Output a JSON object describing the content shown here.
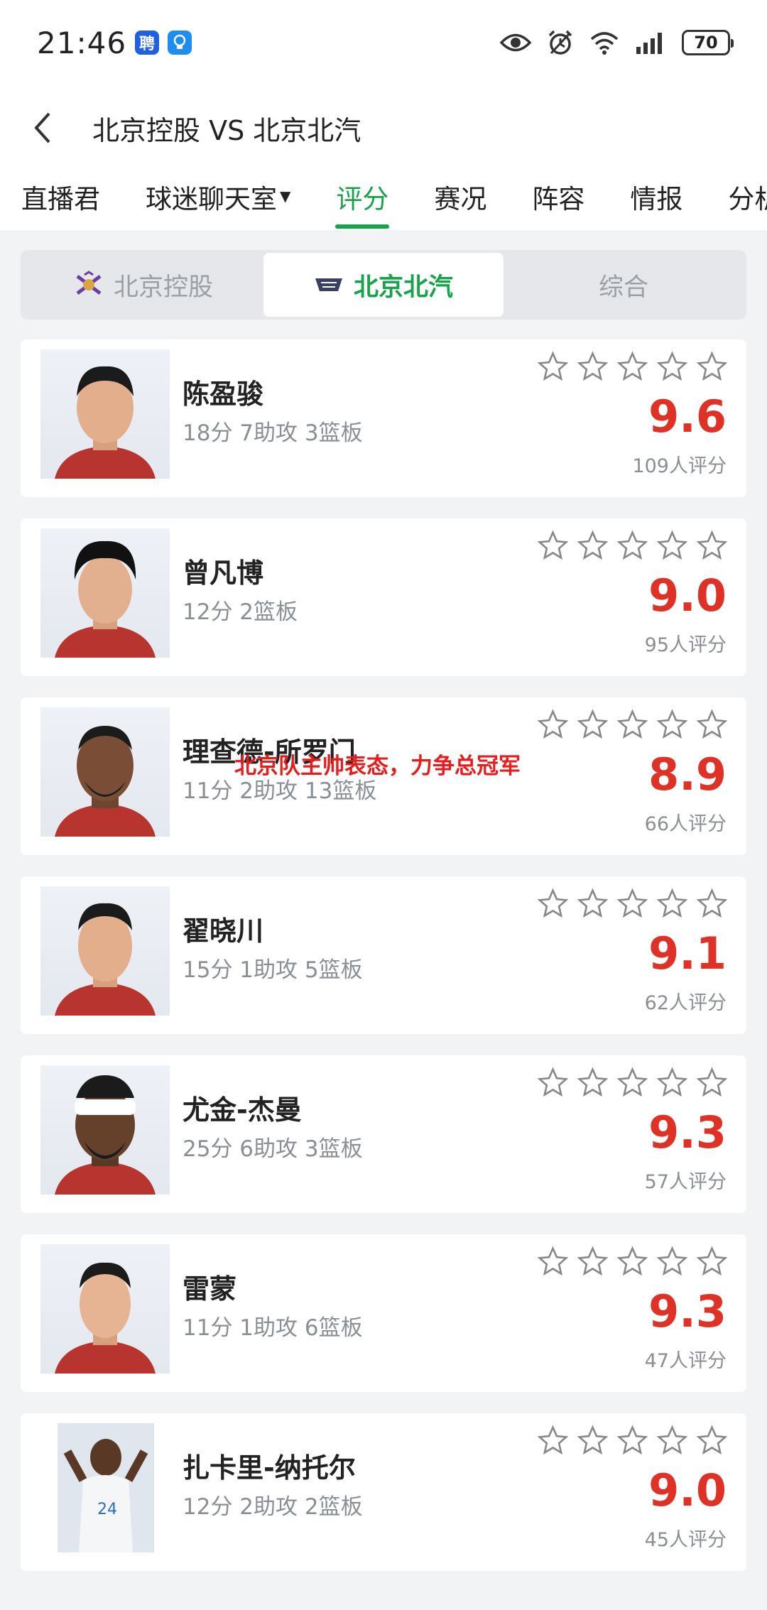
{
  "status_bar": {
    "time": "21:46",
    "app_badge_1": "聘",
    "battery": "70"
  },
  "header": {
    "title": "北京控股 VS 北京北汽"
  },
  "tabs": [
    {
      "label": "直播君"
    },
    {
      "label": "球迷聊天室"
    },
    {
      "label": "评分"
    },
    {
      "label": "赛况"
    },
    {
      "label": "阵容"
    },
    {
      "label": "情报"
    },
    {
      "label": "分析"
    }
  ],
  "team_switch": {
    "team1": "北京控股",
    "team2": "北京北汽",
    "overall": "综合"
  },
  "players": [
    {
      "name": "陈盈骏",
      "stats": "18分 7助攻 3篮板",
      "score": "9.6",
      "raters": "109人评分"
    },
    {
      "name": "曾凡博",
      "stats": "12分 2篮板",
      "score": "9.0",
      "raters": "95人评分"
    },
    {
      "name": "理查德-所罗门",
      "stats": "11分 2助攻 13篮板",
      "score": "8.9",
      "raters": "66人评分"
    },
    {
      "name": "翟晓川",
      "stats": "15分 1助攻 5篮板",
      "score": "9.1",
      "raters": "62人评分"
    },
    {
      "name": "尤金-杰曼",
      "stats": "25分 6助攻 3篮板",
      "score": "9.3",
      "raters": "57人评分"
    },
    {
      "name": "雷蒙",
      "stats": "11分 1助攻 6篮板",
      "score": "9.3",
      "raters": "47人评分"
    },
    {
      "name": "扎卡里-纳托尔",
      "stats": "12分 2助攻 2篮板",
      "score": "9.0",
      "raters": "45人评分"
    }
  ],
  "overlay": "北京队主帅表态，力争总冠军",
  "colors": {
    "accent_green": "#16a34a",
    "score_red": "#e03127"
  }
}
